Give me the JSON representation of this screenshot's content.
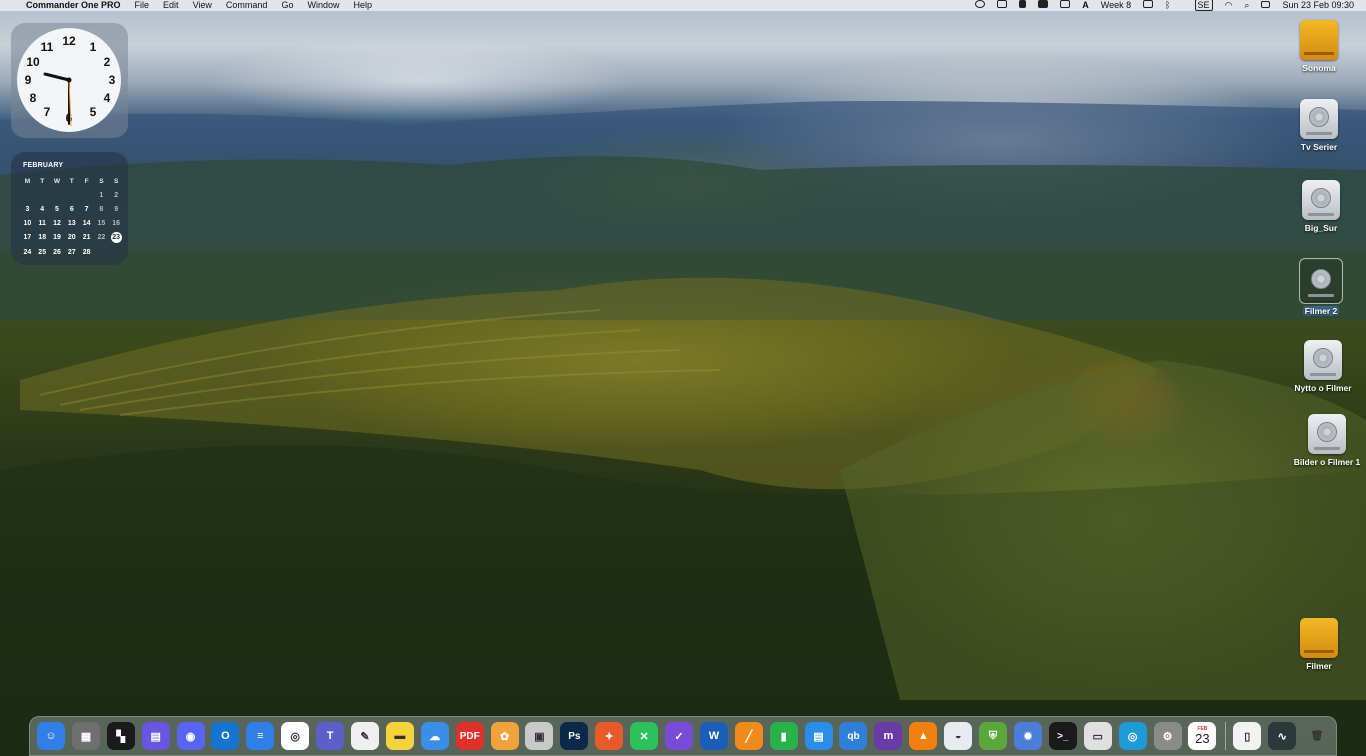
{
  "menubar": {
    "apple": "",
    "app_name": "Commander One PRO",
    "menus": [
      "File",
      "Edit",
      "View",
      "Command",
      "Go",
      "Window",
      "Help"
    ],
    "status": {
      "week": "Week 8",
      "input_source": "SE",
      "datetime": "Sun 23 Feb  09:30"
    }
  },
  "clock_widget": {
    "numbers": [
      "12",
      "1",
      "2",
      "3",
      "4",
      "5",
      "6",
      "7",
      "8",
      "9",
      "10",
      "11"
    ],
    "hour": 9,
    "minute": 30
  },
  "calendar_widget": {
    "month": "FEBRUARY",
    "weekdays": [
      "M",
      "T",
      "W",
      "T",
      "F",
      "S",
      "S"
    ],
    "weeks": [
      [
        "",
        "",
        "",
        "",
        "",
        "1",
        "2"
      ],
      [
        "3",
        "4",
        "5",
        "6",
        "7",
        "8",
        "9"
      ],
      [
        "10",
        "11",
        "12",
        "13",
        "14",
        "15",
        "16"
      ],
      [
        "17",
        "18",
        "19",
        "20",
        "21",
        "22",
        "23"
      ],
      [
        "24",
        "25",
        "26",
        "27",
        "28",
        "",
        ""
      ]
    ],
    "today": "23"
  },
  "desktop_icons": [
    {
      "label": "Sonoma",
      "kind": "gold-drive-icon"
    },
    {
      "label": "Tv Serier",
      "kind": "hard-drive-icon"
    },
    {
      "label": "Big_Sur",
      "kind": "hard-drive-icon"
    },
    {
      "label": "Filmer 2",
      "kind": "hard-drive-icon",
      "selected": true
    },
    {
      "label": "Nytto o Filmer",
      "kind": "hard-drive-icon"
    },
    {
      "label": "Bilder o Filmer 1",
      "kind": "hard-drive-icon"
    },
    {
      "label": "Filmer",
      "kind": "gold-drive-icon"
    }
  ],
  "dock": {
    "apps": [
      {
        "name": "finder-icon",
        "glyph": "☺",
        "color": "#2f7fe6"
      },
      {
        "name": "calculator-icon",
        "glyph": "▦",
        "color": "#6f6f6f"
      },
      {
        "name": "grid-app-icon",
        "glyph": "▚",
        "color": "#1a1a1a"
      },
      {
        "name": "folder-icon",
        "glyph": "▤",
        "color": "#6a55e0"
      },
      {
        "name": "discord-icon",
        "glyph": "◉",
        "color": "#5865f2"
      },
      {
        "name": "outlook-icon",
        "glyph": "O",
        "color": "#1475d0"
      },
      {
        "name": "notes-list-icon",
        "glyph": "≡",
        "color": "#2f7fe6"
      },
      {
        "name": "chrome-icon",
        "glyph": "◎",
        "color": "#ffffff"
      },
      {
        "name": "teams-icon",
        "glyph": "T",
        "color": "#5b5fc7"
      },
      {
        "name": "textedit-icon",
        "glyph": "✎",
        "color": "#efefef"
      },
      {
        "name": "stickies-icon",
        "glyph": "▬",
        "color": "#f5d33a"
      },
      {
        "name": "weather-icon",
        "glyph": "☁",
        "color": "#3a8ee6"
      },
      {
        "name": "pdf-icon",
        "glyph": "PDF",
        "color": "#e0302a"
      },
      {
        "name": "photos-icon",
        "glyph": "✿",
        "color": "#f2a23a"
      },
      {
        "name": "preview-icon",
        "glyph": "▣",
        "color": "#c9c9c9"
      },
      {
        "name": "photoshop-icon",
        "glyph": "Ps",
        "color": "#0b2a4a"
      },
      {
        "name": "pixelmator-icon",
        "glyph": "✦",
        "color": "#e85a2a"
      },
      {
        "name": "mindnode-icon",
        "glyph": "✕",
        "color": "#2cc15a"
      },
      {
        "name": "omnifocus-icon",
        "glyph": "✓",
        "color": "#7a4ad8"
      },
      {
        "name": "word-icon",
        "glyph": "W",
        "color": "#1b5eb8"
      },
      {
        "name": "pages-icon",
        "glyph": "╱",
        "color": "#f08a1a"
      },
      {
        "name": "numbers-icon",
        "glyph": "▮",
        "color": "#27b24a"
      },
      {
        "name": "keynote-icon",
        "glyph": "▤",
        "color": "#2a8ee8"
      },
      {
        "name": "qbittorrent-icon",
        "glyph": "qb",
        "color": "#2d7fd8"
      },
      {
        "name": "imovie-icon",
        "glyph": "m",
        "color": "#6a3aa8"
      },
      {
        "name": "vlc-icon",
        "glyph": "▲",
        "color": "#f08010"
      },
      {
        "name": "disk-utility-icon",
        "glyph": "◒",
        "color": "#e8ecf0"
      },
      {
        "name": "adguard-icon",
        "glyph": "⛨",
        "color": "#5aa83a"
      },
      {
        "name": "settings-gear-icon",
        "glyph": "✹",
        "color": "#4a7ed8"
      },
      {
        "name": "terminal-icon",
        "glyph": ">_",
        "color": "#1a1a1a"
      },
      {
        "name": "scanner-icon",
        "glyph": "▭",
        "color": "#e0e0e0"
      },
      {
        "name": "safari-like-icon",
        "glyph": "◎",
        "color": "#1e9ad6"
      },
      {
        "name": "system-settings-icon",
        "glyph": "⚙",
        "color": "#8a8a8a"
      },
      {
        "name": "calendar-icon",
        "glyph": "",
        "color": "#ffffff"
      }
    ],
    "calendar_month": "FEB",
    "calendar_day": "23",
    "right": [
      {
        "name": "document-icon",
        "glyph": "▯",
        "color": "#f2f2f2"
      },
      {
        "name": "activity-monitor-icon",
        "glyph": "∿",
        "color": "#2a3a3a"
      },
      {
        "name": "trash-icon",
        "glyph": "🗑",
        "color": "transparent"
      }
    ]
  }
}
